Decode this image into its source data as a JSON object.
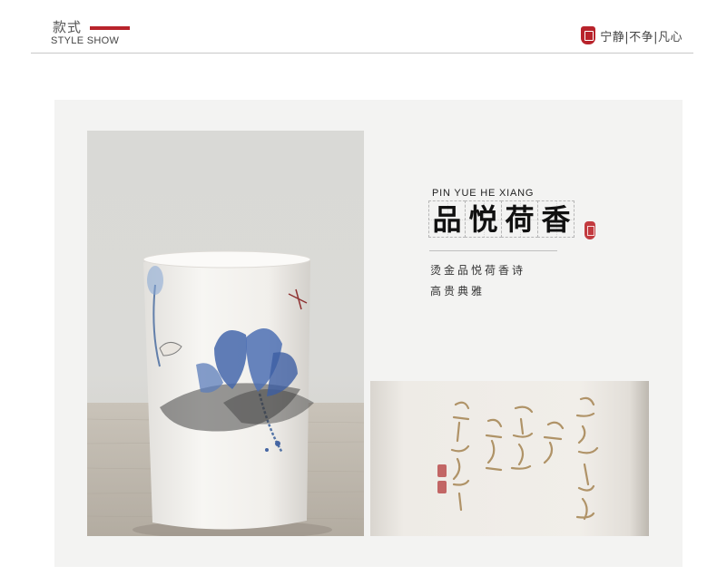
{
  "header": {
    "title_cn": "款式",
    "title_en": "STYLE SHOW",
    "motto": "宁静|不争|凡心",
    "accent_color": "#b8232b"
  },
  "product": {
    "pinyin": "PIN YUE HE XIANG",
    "name_chars": [
      "品",
      "悦",
      "荷",
      "香"
    ],
    "description": [
      "烫金品悦荷香诗",
      "高贵典雅"
    ]
  }
}
